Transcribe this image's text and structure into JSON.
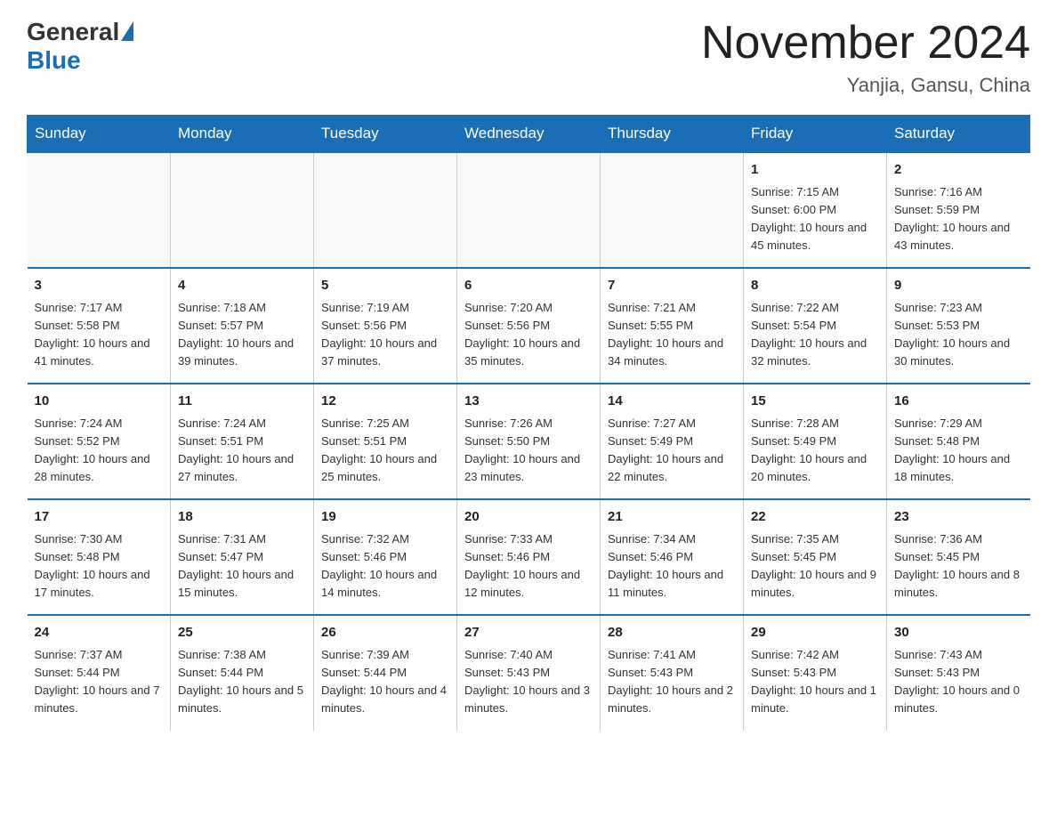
{
  "header": {
    "logo_general": "General",
    "logo_blue": "Blue",
    "title": "November 2024",
    "subtitle": "Yanjia, Gansu, China"
  },
  "weekdays": [
    "Sunday",
    "Monday",
    "Tuesday",
    "Wednesday",
    "Thursday",
    "Friday",
    "Saturday"
  ],
  "weeks": [
    [
      {
        "day": "",
        "sunrise": "",
        "sunset": "",
        "daylight": ""
      },
      {
        "day": "",
        "sunrise": "",
        "sunset": "",
        "daylight": ""
      },
      {
        "day": "",
        "sunrise": "",
        "sunset": "",
        "daylight": ""
      },
      {
        "day": "",
        "sunrise": "",
        "sunset": "",
        "daylight": ""
      },
      {
        "day": "",
        "sunrise": "",
        "sunset": "",
        "daylight": ""
      },
      {
        "day": "1",
        "sunrise": "Sunrise: 7:15 AM",
        "sunset": "Sunset: 6:00 PM",
        "daylight": "Daylight: 10 hours and 45 minutes."
      },
      {
        "day": "2",
        "sunrise": "Sunrise: 7:16 AM",
        "sunset": "Sunset: 5:59 PM",
        "daylight": "Daylight: 10 hours and 43 minutes."
      }
    ],
    [
      {
        "day": "3",
        "sunrise": "Sunrise: 7:17 AM",
        "sunset": "Sunset: 5:58 PM",
        "daylight": "Daylight: 10 hours and 41 minutes."
      },
      {
        "day": "4",
        "sunrise": "Sunrise: 7:18 AM",
        "sunset": "Sunset: 5:57 PM",
        "daylight": "Daylight: 10 hours and 39 minutes."
      },
      {
        "day": "5",
        "sunrise": "Sunrise: 7:19 AM",
        "sunset": "Sunset: 5:56 PM",
        "daylight": "Daylight: 10 hours and 37 minutes."
      },
      {
        "day": "6",
        "sunrise": "Sunrise: 7:20 AM",
        "sunset": "Sunset: 5:56 PM",
        "daylight": "Daylight: 10 hours and 35 minutes."
      },
      {
        "day": "7",
        "sunrise": "Sunrise: 7:21 AM",
        "sunset": "Sunset: 5:55 PM",
        "daylight": "Daylight: 10 hours and 34 minutes."
      },
      {
        "day": "8",
        "sunrise": "Sunrise: 7:22 AM",
        "sunset": "Sunset: 5:54 PM",
        "daylight": "Daylight: 10 hours and 32 minutes."
      },
      {
        "day": "9",
        "sunrise": "Sunrise: 7:23 AM",
        "sunset": "Sunset: 5:53 PM",
        "daylight": "Daylight: 10 hours and 30 minutes."
      }
    ],
    [
      {
        "day": "10",
        "sunrise": "Sunrise: 7:24 AM",
        "sunset": "Sunset: 5:52 PM",
        "daylight": "Daylight: 10 hours and 28 minutes."
      },
      {
        "day": "11",
        "sunrise": "Sunrise: 7:24 AM",
        "sunset": "Sunset: 5:51 PM",
        "daylight": "Daylight: 10 hours and 27 minutes."
      },
      {
        "day": "12",
        "sunrise": "Sunrise: 7:25 AM",
        "sunset": "Sunset: 5:51 PM",
        "daylight": "Daylight: 10 hours and 25 minutes."
      },
      {
        "day": "13",
        "sunrise": "Sunrise: 7:26 AM",
        "sunset": "Sunset: 5:50 PM",
        "daylight": "Daylight: 10 hours and 23 minutes."
      },
      {
        "day": "14",
        "sunrise": "Sunrise: 7:27 AM",
        "sunset": "Sunset: 5:49 PM",
        "daylight": "Daylight: 10 hours and 22 minutes."
      },
      {
        "day": "15",
        "sunrise": "Sunrise: 7:28 AM",
        "sunset": "Sunset: 5:49 PM",
        "daylight": "Daylight: 10 hours and 20 minutes."
      },
      {
        "day": "16",
        "sunrise": "Sunrise: 7:29 AM",
        "sunset": "Sunset: 5:48 PM",
        "daylight": "Daylight: 10 hours and 18 minutes."
      }
    ],
    [
      {
        "day": "17",
        "sunrise": "Sunrise: 7:30 AM",
        "sunset": "Sunset: 5:48 PM",
        "daylight": "Daylight: 10 hours and 17 minutes."
      },
      {
        "day": "18",
        "sunrise": "Sunrise: 7:31 AM",
        "sunset": "Sunset: 5:47 PM",
        "daylight": "Daylight: 10 hours and 15 minutes."
      },
      {
        "day": "19",
        "sunrise": "Sunrise: 7:32 AM",
        "sunset": "Sunset: 5:46 PM",
        "daylight": "Daylight: 10 hours and 14 minutes."
      },
      {
        "day": "20",
        "sunrise": "Sunrise: 7:33 AM",
        "sunset": "Sunset: 5:46 PM",
        "daylight": "Daylight: 10 hours and 12 minutes."
      },
      {
        "day": "21",
        "sunrise": "Sunrise: 7:34 AM",
        "sunset": "Sunset: 5:46 PM",
        "daylight": "Daylight: 10 hours and 11 minutes."
      },
      {
        "day": "22",
        "sunrise": "Sunrise: 7:35 AM",
        "sunset": "Sunset: 5:45 PM",
        "daylight": "Daylight: 10 hours and 9 minutes."
      },
      {
        "day": "23",
        "sunrise": "Sunrise: 7:36 AM",
        "sunset": "Sunset: 5:45 PM",
        "daylight": "Daylight: 10 hours and 8 minutes."
      }
    ],
    [
      {
        "day": "24",
        "sunrise": "Sunrise: 7:37 AM",
        "sunset": "Sunset: 5:44 PM",
        "daylight": "Daylight: 10 hours and 7 minutes."
      },
      {
        "day": "25",
        "sunrise": "Sunrise: 7:38 AM",
        "sunset": "Sunset: 5:44 PM",
        "daylight": "Daylight: 10 hours and 5 minutes."
      },
      {
        "day": "26",
        "sunrise": "Sunrise: 7:39 AM",
        "sunset": "Sunset: 5:44 PM",
        "daylight": "Daylight: 10 hours and 4 minutes."
      },
      {
        "day": "27",
        "sunrise": "Sunrise: 7:40 AM",
        "sunset": "Sunset: 5:43 PM",
        "daylight": "Daylight: 10 hours and 3 minutes."
      },
      {
        "day": "28",
        "sunrise": "Sunrise: 7:41 AM",
        "sunset": "Sunset: 5:43 PM",
        "daylight": "Daylight: 10 hours and 2 minutes."
      },
      {
        "day": "29",
        "sunrise": "Sunrise: 7:42 AM",
        "sunset": "Sunset: 5:43 PM",
        "daylight": "Daylight: 10 hours and 1 minute."
      },
      {
        "day": "30",
        "sunrise": "Sunrise: 7:43 AM",
        "sunset": "Sunset: 5:43 PM",
        "daylight": "Daylight: 10 hours and 0 minutes."
      }
    ]
  ]
}
